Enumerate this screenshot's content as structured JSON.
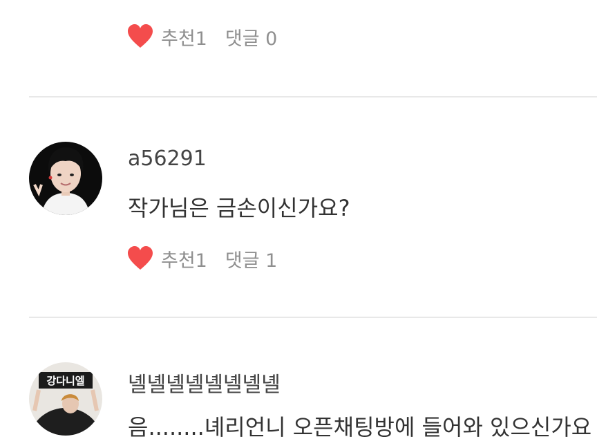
{
  "comments": [
    {
      "likes_label": "추천1",
      "replies_label": "댓글 0"
    },
    {
      "username": "a56291",
      "text": "작가님은 금손이신가요?",
      "likes_label": "추천1",
      "replies_label": "댓글 1"
    },
    {
      "username": "녤녤녤녤녤녤녤녤",
      "text": "음........녜리언니 오픈채팅방에 들어와 있으신가요",
      "avatar_sign": "강다니엘"
    }
  ],
  "colors": {
    "heart": "#f44c4c",
    "meta_text": "#8f8f8f",
    "divider": "#e8e8e8"
  }
}
